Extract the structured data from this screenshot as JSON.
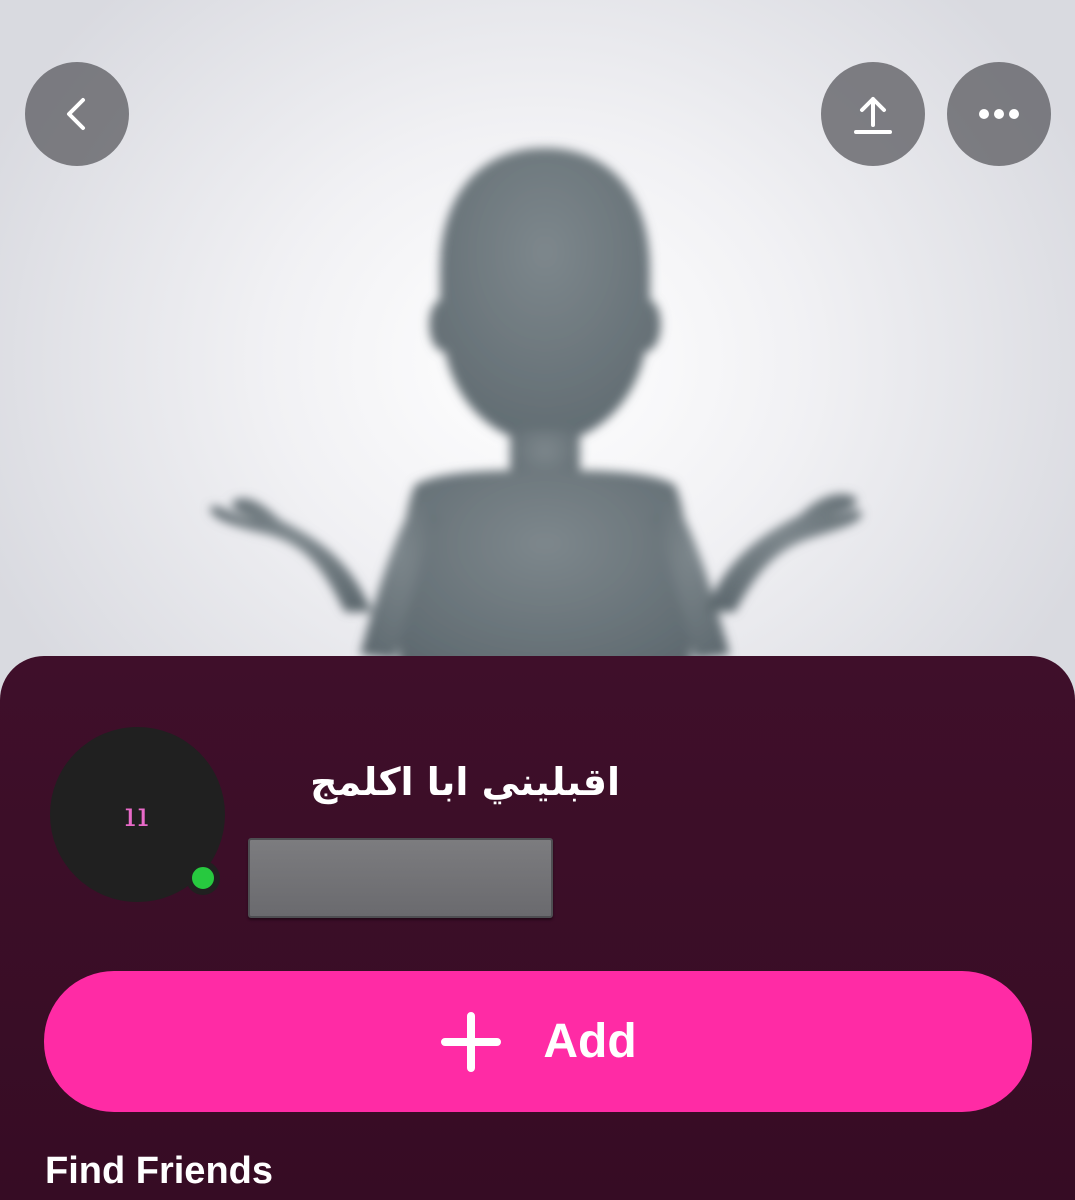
{
  "header": {
    "back_icon": "chevron-left-icon",
    "share_icon": "share-upload-icon",
    "more_icon": "more-horizontal-icon"
  },
  "profile": {
    "display_name": "اقبليني ابا اكلمج",
    "avatar_mark": "ıı",
    "online_status_color": "#27c93f"
  },
  "actions": {
    "add_label": "Add",
    "add_color": "#ff2ba5"
  },
  "sections": {
    "find_friends_title": "Find Friends"
  },
  "colors": {
    "card_background": "#3f0f2a",
    "avatar_silhouette": "#6f7a80"
  }
}
